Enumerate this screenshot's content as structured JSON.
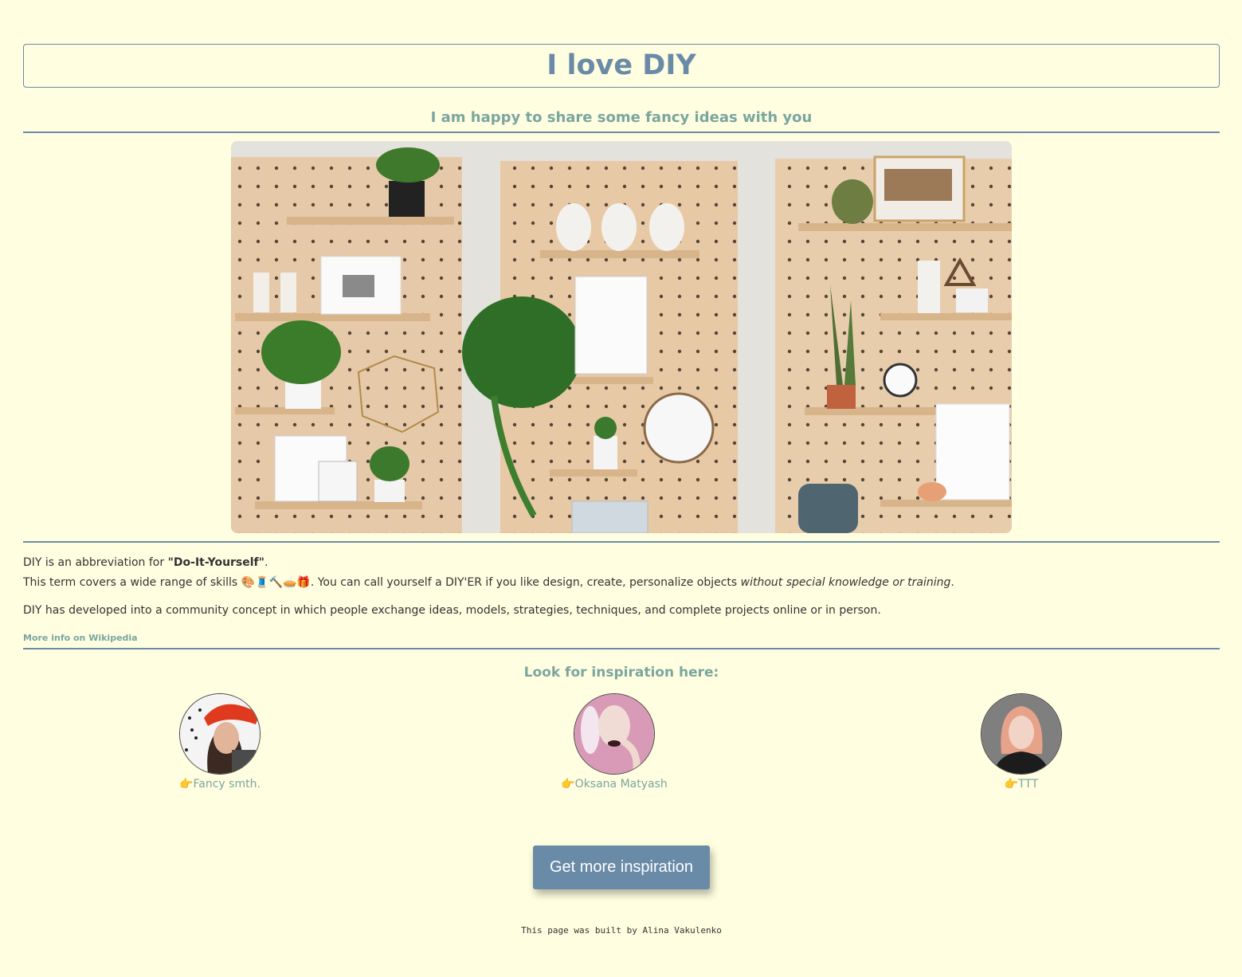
{
  "header": {
    "title": "I love DIY",
    "subtitle": "I am happy to share some fancy ideas with you"
  },
  "hero": {
    "image_name": "pegboard-shelves-photo"
  },
  "description": {
    "line1_prefix": "DIY is an abbreviation for ",
    "line1_bold": "\"Do-It-Yourself\"",
    "line1_suffix": ".",
    "line2_prefix": "This term covers a wide range of skills ",
    "skills_emoji": "🎨🧵🔨🥧🎁",
    "line2_middle": ". You can call yourself a DIY'ER if you like design, create, personalize objects ",
    "line2_italic": "without special knowledge or training",
    "line2_suffix": ".",
    "paragraph2": "DIY has developed into a community concept in which people exchange ideas, models, strategies, techniques, and complete projects online or in person.",
    "wiki_link": "More info on Wikipedia"
  },
  "inspiration": {
    "title": "Look for inspiration here:",
    "pointer": "👉",
    "profiles": [
      {
        "name": "Fancy smth."
      },
      {
        "name": "Oksana Matyash"
      },
      {
        "name": "TTT"
      }
    ]
  },
  "button": {
    "label": "Get more inspiration"
  },
  "footer": {
    "text": "This page was built by Alina Vakulenko"
  },
  "colors": {
    "background": "#fffee0",
    "accent": "#6a8ba8",
    "teal": "#7aa6a0"
  }
}
